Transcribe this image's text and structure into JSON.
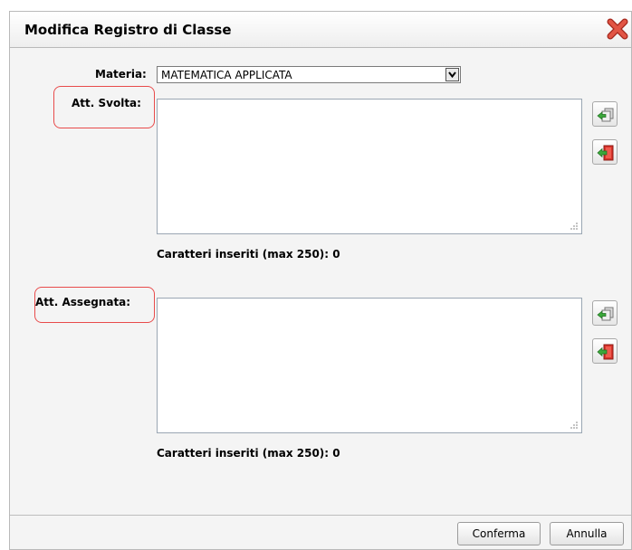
{
  "dialog": {
    "title": "Modifica Registro di Classe",
    "close_icon": "close-x-icon"
  },
  "form": {
    "materia_label": "Materia:",
    "materia_value": "MATEMATICA APPLICATA",
    "svolta_label": "Att. Svolta:",
    "svolta_value": "",
    "svolta_counter": "Caratteri inseriti (max 250): 0",
    "assegnata_label": "Att. Assegnata:",
    "assegnata_value": "",
    "assegnata_counter": "Caratteri inseriti (max 250): 0",
    "side_icons": [
      "copy-icon",
      "exit-icon"
    ]
  },
  "footer": {
    "confirm_label": "Conferma",
    "cancel_label": "Annulla"
  },
  "colors": {
    "highlight": "#e84b4b",
    "close_icon": "#d63a2c"
  }
}
